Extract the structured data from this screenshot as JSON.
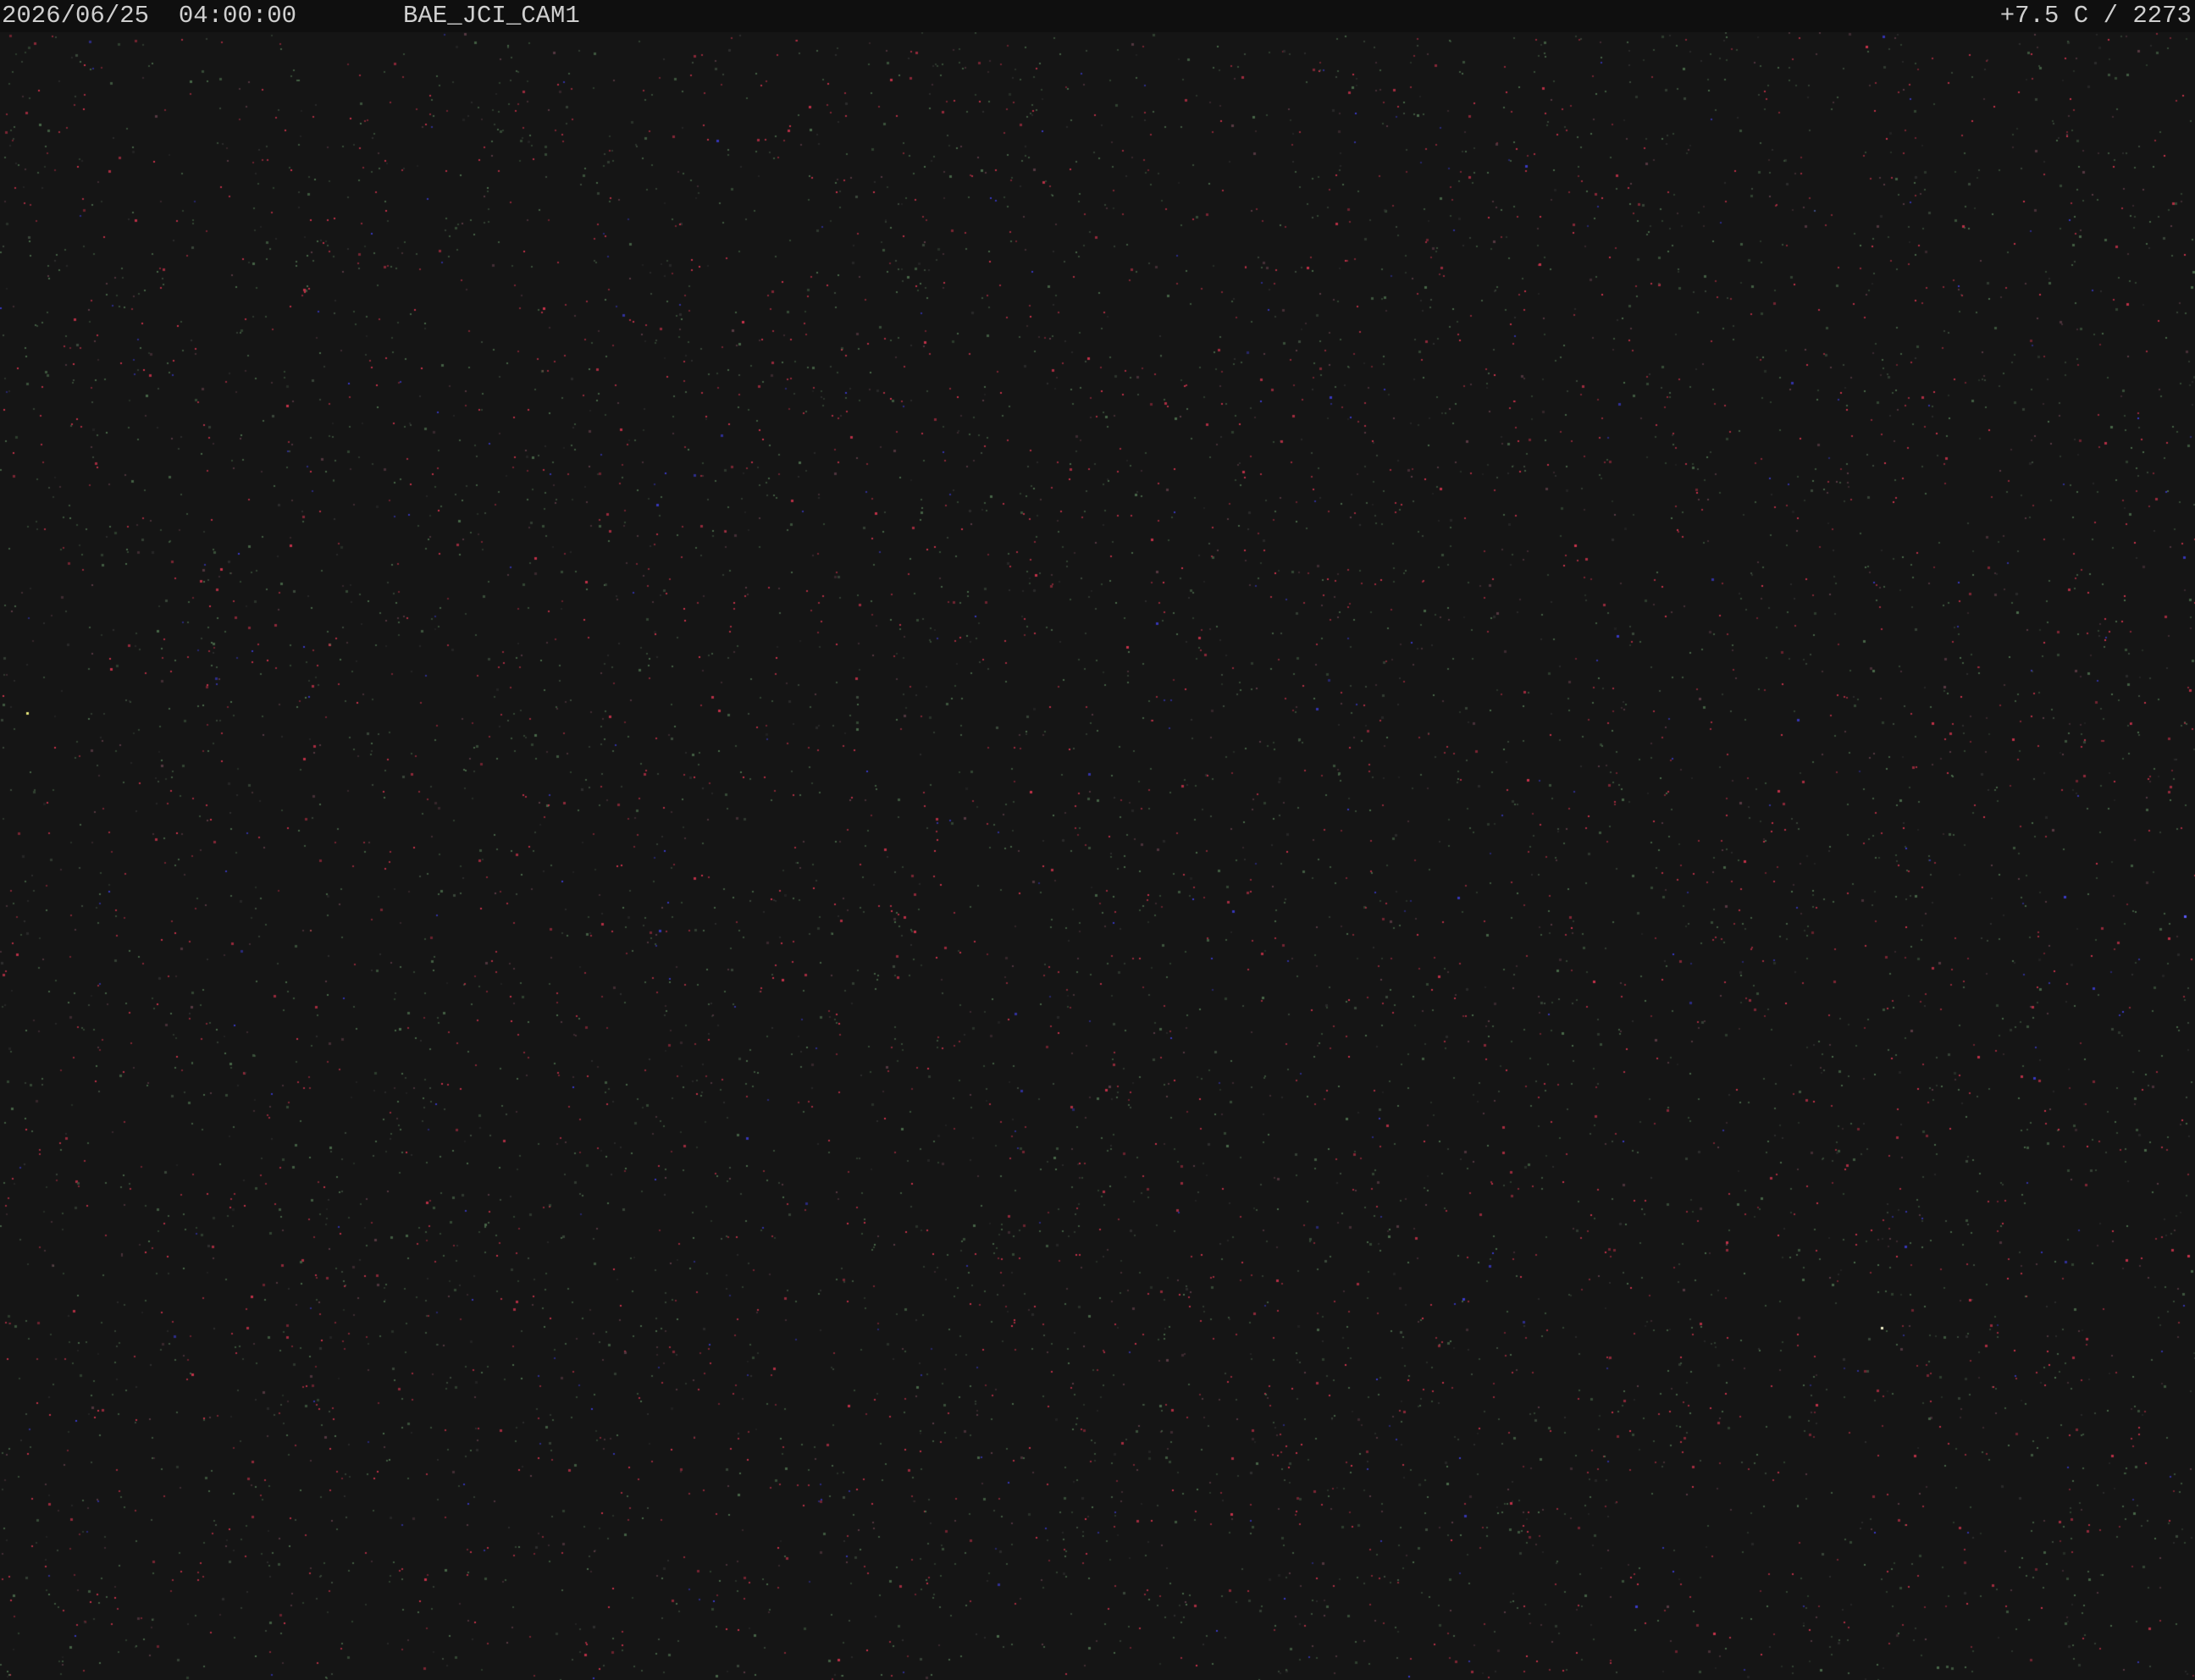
{
  "overlay": {
    "datetime": "2026/06/25  04:00:00",
    "camera_id": "BAE_JCI_CAM1",
    "temperature_readout": "+7.5 C / 2273"
  },
  "colors": {
    "sky_background": "#151515",
    "overlay_bar": "#0f0f0f",
    "overlay_text": "#cfcfcf",
    "hot_pixel_red": "#c8324a",
    "hot_pixel_green": "#4a6a4a",
    "hot_pixel_blue": "#3a3ac8"
  },
  "scene": {
    "content": "night-sky-sensor-noise"
  }
}
